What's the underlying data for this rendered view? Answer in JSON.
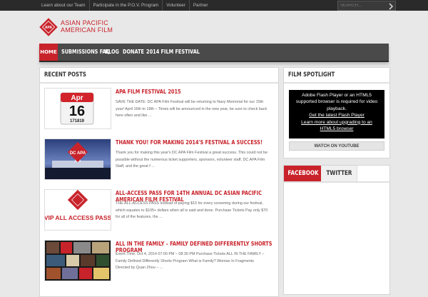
{
  "topbar": {
    "links": [
      "Learn about our Team",
      "Participate in the P.O.V. Program",
      "Volunteer",
      "Partner"
    ],
    "search_placeholder": "SEARCH..."
  },
  "logo": {
    "line1": "ASIAN PACIFIC",
    "line2": "AMERICAN FILM",
    "mark_text": "APA"
  },
  "nav": {
    "items": [
      "HOME",
      "SUBMISSIONS FAQ",
      "BLOG",
      "DONATE",
      "2014 FILM FESTIVAL"
    ],
    "active": "HOME"
  },
  "recent": {
    "title": "RECENT POSTS",
    "posts": [
      {
        "title": "APA FILM FESTIVAL 2015",
        "excerpt": "SAVE THE DATE: DC APA Film Festival will be returning to Navy Memorial for our 15th year! April 16th to 19th – Times will be announced in the new year, be sure to check back here often and like ...",
        "thumb_month": "Apr",
        "thumb_day": "16",
        "thumb_range": "171819"
      },
      {
        "title": "THANK YOU! FOR MAKING 2014'S FESTIVAL A SUCCESS!",
        "excerpt": "Thank you for making this year's DC APA Film Festival a great success. This could not be possible without the numerous ticket supporters, sponsors, volunteer staff, DC APA Film Staff, and the great f ...",
        "thumb_text": "DC APA"
      },
      {
        "title": "ALL-ACCESS PASS FOR 14TH ANNUAL DC ASIAN PACIFIC AMERICAN FILM FESTIVAL",
        "excerpt": "THE ALL-ACCESS PASS Instead of paying $15 for every screening during our festival, which equates to $105+ dollars when all is said and done. Purchase Tickets Pay only $70 for all of the features, the ...",
        "thumb_text": "VIP ALL ACCESS PASS"
      },
      {
        "title": "ALL IN THE FAMILY – FAMILY DEFINED DIFFERENTLY SHORTS PROGRAM",
        "excerpt": "Event Time: Oct 4, 2014 07:00 PM – 08:30 PM Purchase Tickets ALL IN THE FAMILY – Family Defined Differently Shorts Program What is Family? Woman In Fragments Directed by Quan Zhou – ..."
      }
    ]
  },
  "spotlight": {
    "title": "FILM SPOTLIGHT",
    "flash_lines": [
      "Adobe Flash Player or an HTML5",
      "supported browser is required for video",
      "playback."
    ],
    "flash_link1": "Get the latest Flash Player",
    "flash_link2_lines": [
      "Learn more about upgrading to an",
      "HTML5 browser"
    ],
    "watch_label": "WATCH ON YOUTUBE"
  },
  "social": {
    "tabs": [
      "FACEBOOK",
      "TWITTER"
    ],
    "active": "FACEBOOK"
  },
  "colors": {
    "accent": "#c8232b",
    "topbar": "#2a2a2a",
    "nav": "#4a4a4a",
    "background": "#e9e8e8"
  }
}
